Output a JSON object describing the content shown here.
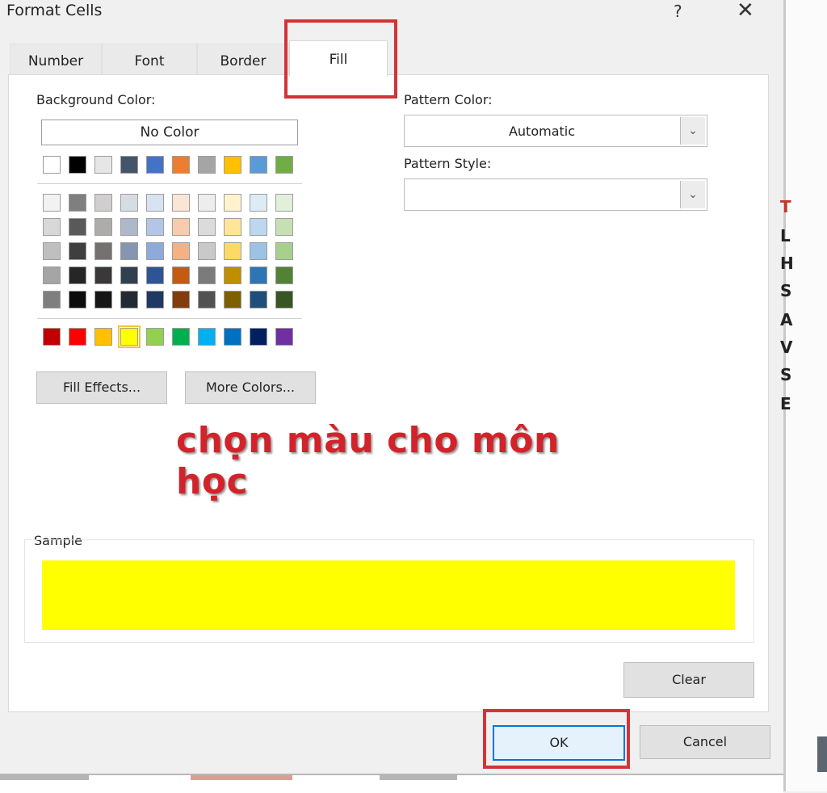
{
  "dialog": {
    "title": "Format Cells",
    "help": "?",
    "close": "✕"
  },
  "tabs": [
    {
      "label": "Number"
    },
    {
      "label": "Font"
    },
    {
      "label": "Border"
    },
    {
      "label": "Fill",
      "selected": true
    }
  ],
  "background": {
    "label": "Background Color:",
    "no_color": "No Color",
    "theme_top_row": [
      "#ffffff",
      "#000000",
      "#e7e6e6",
      "#44546a",
      "#4472c4",
      "#ed7d31",
      "#a5a5a5",
      "#ffc000",
      "#5b9bd5",
      "#70ad47"
    ],
    "theme_shades": [
      [
        "#f2f2f2",
        "#7f7f7f",
        "#d0cece",
        "#d6dce4",
        "#d9e2f3",
        "#fbe5d5",
        "#ededed",
        "#fff2cc",
        "#ddebf7",
        "#e2efd9"
      ],
      [
        "#d8d8d8",
        "#595959",
        "#aeabab",
        "#adb9ca",
        "#b4c6e7",
        "#f7cbac",
        "#dbdbdb",
        "#ffe599",
        "#bdd7ee",
        "#c5e0b3"
      ],
      [
        "#bfbfbf",
        "#3f3f3f",
        "#757171",
        "#8496b0",
        "#8eaadb",
        "#f4b183",
        "#c9c9c9",
        "#ffd966",
        "#9cc3e5",
        "#a8d08d"
      ],
      [
        "#a5a5a5",
        "#262626",
        "#3a3838",
        "#323f4f",
        "#2f5496",
        "#c55a11",
        "#7b7b7b",
        "#bf8f00",
        "#2e75b5",
        "#538135"
      ],
      [
        "#7f7f7f",
        "#0c0c0c",
        "#171616",
        "#222a35",
        "#1f3864",
        "#843c0c",
        "#525252",
        "#7f6000",
        "#1e4e79",
        "#375623"
      ]
    ],
    "standard": [
      "#c00000",
      "#ff0000",
      "#ffc000",
      "#ffff00",
      "#92d050",
      "#00b050",
      "#00b0f0",
      "#0070c0",
      "#002060",
      "#7030a0"
    ],
    "selected_standard_index": 3
  },
  "buttons": {
    "fill_effects": "Fill Effects...",
    "more_colors": "More Colors...",
    "clear": "Clear",
    "ok": "OK",
    "cancel": "Cancel"
  },
  "pattern": {
    "color_label": "Pattern Color:",
    "color_value": "Automatic",
    "style_label": "Pattern Style:",
    "style_value": ""
  },
  "annotation": "chọn màu cho môn học",
  "sample": {
    "label": "Sample",
    "color": "#ffff00"
  },
  "highlight_color": "#d13438",
  "right_strip_letters": [
    "T",
    "L",
    "H",
    "S",
    "A",
    "V",
    "S",
    "E"
  ]
}
